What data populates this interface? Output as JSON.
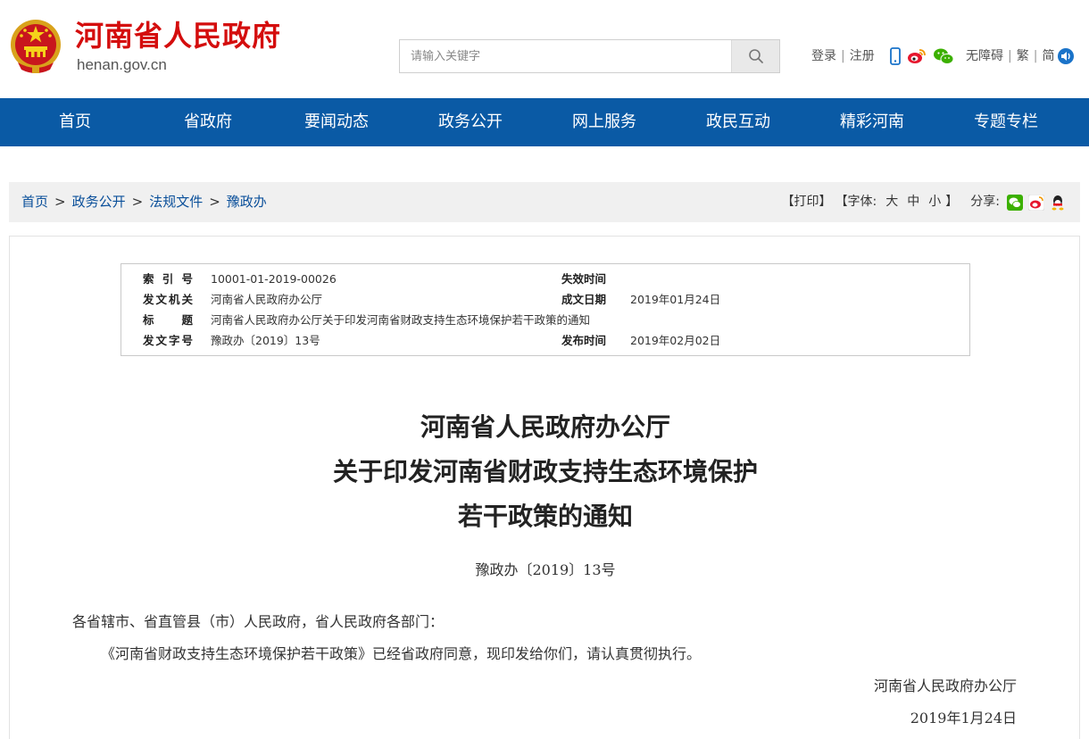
{
  "header": {
    "site_name": "河南省人民政府",
    "site_domain": "henan.gov.cn",
    "search": {
      "placeholder": "请输入关键字",
      "value": ""
    },
    "login": "登录",
    "register": "注册",
    "social_icons": [
      "mobile-icon",
      "weibo-icon",
      "wechat-icon"
    ],
    "accessibility": "无障碍",
    "traditional": "繁",
    "simplified": "简",
    "colors": {
      "brand_red": "#d40d0d",
      "nav_blue": "#0a5aa5"
    }
  },
  "nav": {
    "items": [
      "首页",
      "省政府",
      "要闻动态",
      "政务公开",
      "网上服务",
      "政民互动",
      "精彩河南",
      "专题专栏"
    ]
  },
  "breadcrumb": {
    "items": [
      "首页",
      "政务公开",
      "法规文件",
      "豫政办"
    ],
    "separator": ">"
  },
  "tools": {
    "print": "【打印】",
    "font_label": "【字体:",
    "font_large": "大",
    "font_medium": "中",
    "font_small": "小",
    "font_close": "】",
    "share_label": "分享:",
    "share_icons": [
      "wechat-icon",
      "weibo-icon",
      "qq-icon"
    ]
  },
  "meta": {
    "index_label": "索 引 号",
    "index_value": "10001-01-2019-00026",
    "expiry_label": "失效时间",
    "expiry_value": "",
    "issuer_label": "发文机关",
    "issuer_value": "河南省人民政府办公厅",
    "written_label": "成文日期",
    "written_value": "2019年01月24日",
    "title_label": "标　　题",
    "title_value": "河南省人民政府办公厅关于印发河南省财政支持生态环境保护若干政策的通知",
    "docno_label": "发文字号",
    "docno_value": "豫政办〔2019〕13号",
    "publish_label": "发布时间",
    "publish_value": "2019年02月02日"
  },
  "document": {
    "title_line1": "河南省人民政府办公厅",
    "title_line2": "关于印发河南省财政支持生态环境保护",
    "title_line3": "若干政策的通知",
    "number": "豫政办〔2019〕13号",
    "salutation": "各省辖市、省直管县（市）人民政府，省人民政府各部门：",
    "paragraph1": "《河南省财政支持生态环境保护若干政策》已经省政府同意，现印发给你们，请认真贯彻执行。",
    "signature_org": "河南省人民政府办公厅",
    "signature_date": "2019年1月24日"
  }
}
